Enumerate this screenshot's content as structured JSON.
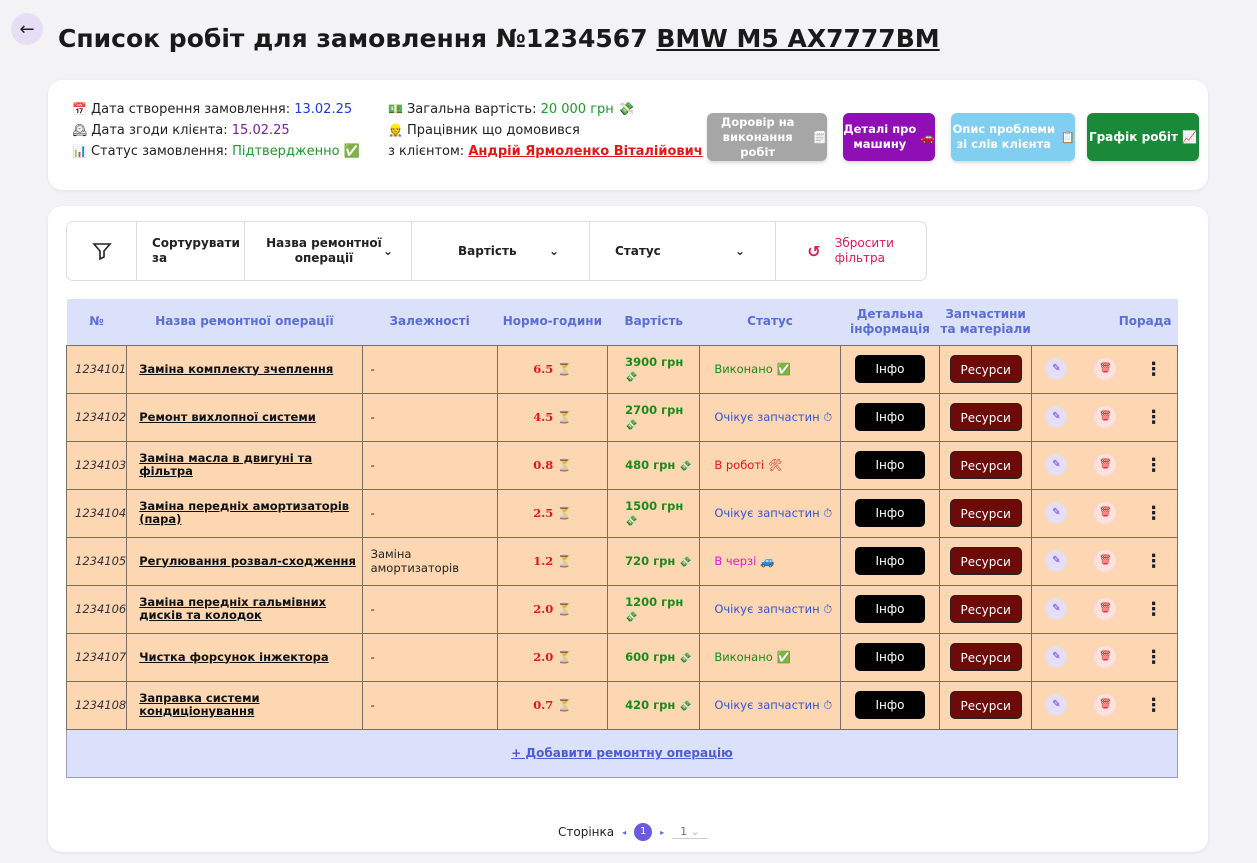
{
  "header": {
    "title": "Список робіт для замовлення №1234567",
    "car": "BMW M5 AX7777BM"
  },
  "info": {
    "created_label": "Дата створення замовлення:",
    "created_value": "13.02.25",
    "agreed_label": "Дата згоди клієнта:",
    "agreed_value": "15.02.25",
    "status_label": "Статус замовлення:",
    "status_value": "Підтвердженно",
    "total_label": "Загальна вартість:",
    "total_value": "20 000 грн",
    "worker_label_1": "Працівник що домовився",
    "worker_label_2": "з клієнтом:",
    "worker_value": "Андрій Ярмоленко Віталійович"
  },
  "actions": {
    "contract": "Доровір на виконання робіт",
    "car_details": "Деталі про машину",
    "problem": "Опис проблеми зі слів клієнта",
    "schedule": "Графік робіт"
  },
  "filters": {
    "sort": "Сортурувати за",
    "name": "Назва ремонтної операції",
    "cost": "Вартість",
    "status": "Статус",
    "reset": "Збросити фільтра"
  },
  "table": {
    "headers": {
      "num": "№",
      "name": "Назва ремонтної операції",
      "deps": "Залежності",
      "hours": "Нормо-години",
      "cost": "Вартість",
      "status": "Статус",
      "info": "Детальна інформація",
      "parts": "Запчастини та матеріали",
      "advice": "Порада"
    },
    "info_btn": "Інфо",
    "res_btn": "Ресурси",
    "rows": [
      {
        "num": "1234101",
        "name": "Заміна комплекту зчеплення",
        "deps": "-",
        "hours": "6.5",
        "cost": "3900 грн",
        "status": "Виконано",
        "status_type": "done"
      },
      {
        "num": "1234102",
        "name": "Ремонт вихлопної системи",
        "deps": "-",
        "hours": "4.5",
        "cost": "2700 грн",
        "status": "Очікує запчастин",
        "status_type": "wait"
      },
      {
        "num": "1234103",
        "name": "Заміна масла в двигуні та фільтра",
        "deps": "-",
        "hours": "0.8",
        "cost": "480 грн",
        "status": "В роботі",
        "status_type": "work"
      },
      {
        "num": "1234104",
        "name": "Заміна передніх амортизаторів (пара)",
        "deps": "-",
        "hours": "2.5",
        "cost": "1500 грн",
        "status": "Очікує запчастин",
        "status_type": "wait"
      },
      {
        "num": "1234105",
        "name": "Регулювання розвал-сходження",
        "deps": "Заміна амортизаторів",
        "hours": "1.2",
        "cost": "720 грн",
        "status": "В черзі",
        "status_type": "queue"
      },
      {
        "num": "1234106",
        "name": "Заміна передніх гальмівних дисків та колодок",
        "deps": "-",
        "hours": "2.0",
        "cost": "1200 грн",
        "status": "Очікує запчастин",
        "status_type": "wait"
      },
      {
        "num": "1234107",
        "name": "Чистка форсунок інжектора",
        "deps": "-",
        "hours": "2.0",
        "cost": "600 грн",
        "status": "Виконано",
        "status_type": "done"
      },
      {
        "num": "1234108",
        "name": "Заправка системи кондиціонування",
        "deps": "-",
        "hours": "0.7",
        "cost": "420 грн",
        "status": "Очікує запчастин",
        "status_type": "wait"
      }
    ],
    "add_label": "+ Добавити ремонтну операцію"
  },
  "pager": {
    "label": "Сторінка",
    "current": "1",
    "page_size": "1"
  }
}
